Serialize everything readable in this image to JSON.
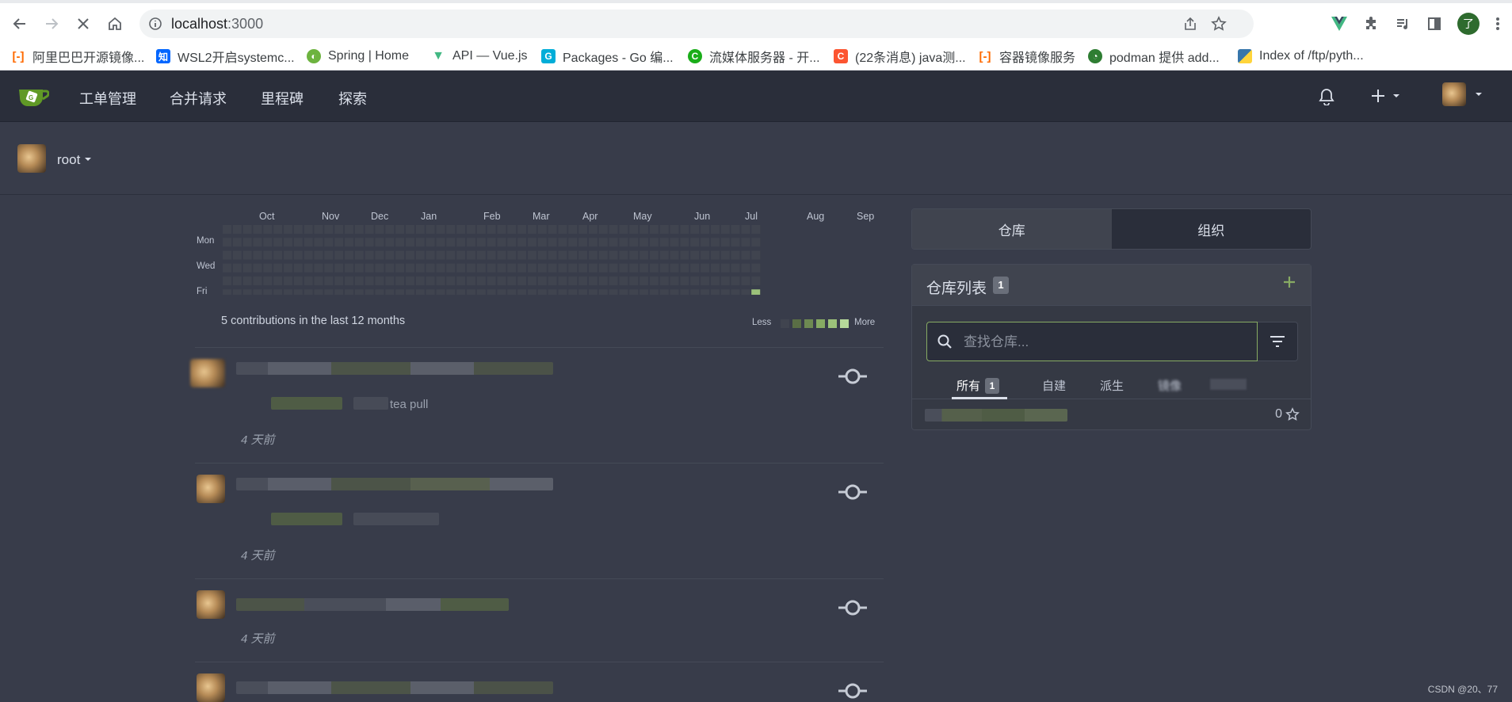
{
  "browser": {
    "url_host": "localhost",
    "url_port": ":3000",
    "profile_initial": "了"
  },
  "bookmarks": [
    {
      "label": "阿里巴巴开源镜像...",
      "icon": "alibaba-icon",
      "color": "#ff6a00"
    },
    {
      "label": "WSL2开启systemc...",
      "icon": "zhihu-icon",
      "color": "#0066ff"
    },
    {
      "label": "Spring | Home",
      "icon": "spring-icon",
      "color": "#6db33f"
    },
    {
      "label": "API — Vue.js",
      "icon": "vue-icon",
      "color": "#42b883"
    },
    {
      "label": "Packages - Go 编...",
      "icon": "go-icon",
      "color": "#00add8"
    },
    {
      "label": "流媒体服务器 - 开...",
      "icon": "media-server-icon",
      "color": "#1aad19"
    },
    {
      "label": "(22条消息) java测...",
      "icon": "csdn-icon",
      "color": "#fc5531"
    },
    {
      "label": "容器镜像服务",
      "icon": "alibaba-icon",
      "color": "#ff6a00"
    },
    {
      "label": "podman 提供 add...",
      "icon": "podman-icon",
      "color": "#2e7d32"
    },
    {
      "label": "Index of /ftp/pyth...",
      "icon": "python-icon",
      "color": "#3776ab"
    }
  ],
  "nav": {
    "items": [
      "工单管理",
      "合并请求",
      "里程碑",
      "探索"
    ],
    "colors": {
      "bg": "#2a2e3a",
      "accent": "#87ab63"
    }
  },
  "dashboard": {
    "context_user": "root"
  },
  "heatmap": {
    "months": [
      "Oct",
      "Nov",
      "Dec",
      "Jan",
      "Feb",
      "Mar",
      "Apr",
      "May",
      "Jun",
      "Jul",
      "Aug",
      "Sep"
    ],
    "day_labels": [
      "Mon",
      "Wed",
      "Fri"
    ],
    "summary": "5 contributions in the last 12 months",
    "legend_less": "Less",
    "legend_more": "More",
    "legend_colors": [
      "#40444f",
      "#5a6e45",
      "#6e8a52",
      "#87ab63",
      "#9cc27a",
      "#b6d99a"
    ],
    "active_cell": {
      "week": 52,
      "day": 5,
      "level": 4
    }
  },
  "feed": [
    {
      "detail_text": "tea pull",
      "time": "4 天前"
    },
    {
      "detail_text": "",
      "time": "4 天前"
    },
    {
      "detail_text": "",
      "time": "4 天前"
    },
    {
      "detail_text": "",
      "time": ""
    }
  ],
  "right_panel": {
    "tabs": [
      "仓库",
      "组织"
    ],
    "repo_list_title": "仓库列表",
    "repo_count": "1",
    "search_placeholder": "查找仓库...",
    "subtabs": [
      {
        "label": "所有",
        "count": "1"
      },
      {
        "label": "自建"
      },
      {
        "label": "派生"
      },
      {
        "label": "镜像"
      }
    ],
    "repo_stars": "0"
  },
  "watermark": "CSDN @20、77"
}
